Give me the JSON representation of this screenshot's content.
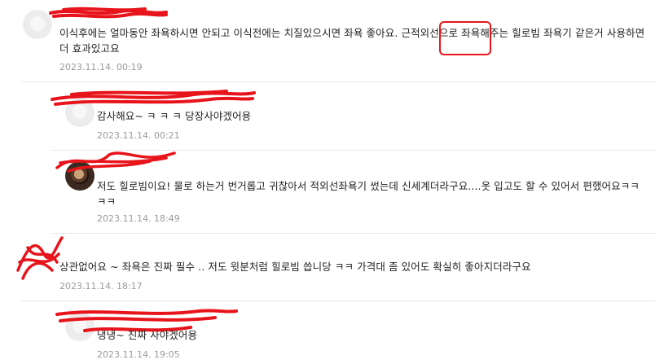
{
  "comments": [
    {
      "text_a": "이식후에는 얼마동안 좌욕하시면 안되고 이식전에는 치질있으시면 좌욕 좋아요. ",
      "text_b": "근적외선",
      "text_c": "으로 좌욕해주는 힐로빔 좌욕기 같은거 사용하면 더 효과있고요",
      "date": "2023.11.14. 00:19"
    },
    {
      "text": "감사해요~ ㅋ ㅋ ㅋ 당장사야겠어용",
      "date": "2023.11.14. 00:21"
    },
    {
      "text": "저도 힐로빔이요! 물로 하는거 번거롭고 귀찮아서 적외선좌욕기 썼는데 신세계더라구요....옷 입고도 할 수 있어서 편했어요ㅋㅋㅋㅋ",
      "date": "2023.11.14. 18:49"
    },
    {
      "text": "상관없어요 ~ 좌욕은 진짜 필수 .. 저도 윗분처럼 힐로빔 씁니당 ㅋㅋ 가격대 좀 있어도 확실히 좋아지더라구요",
      "date": "2023.11.14. 18:17"
    },
    {
      "text": "냉냉~ 진짜 사야겠어용",
      "date": "2023.11.14. 19:05"
    }
  ],
  "colors": {
    "redaction": "#e8141b",
    "date": "#9a9a9a",
    "divider": "#e6e6e6"
  }
}
